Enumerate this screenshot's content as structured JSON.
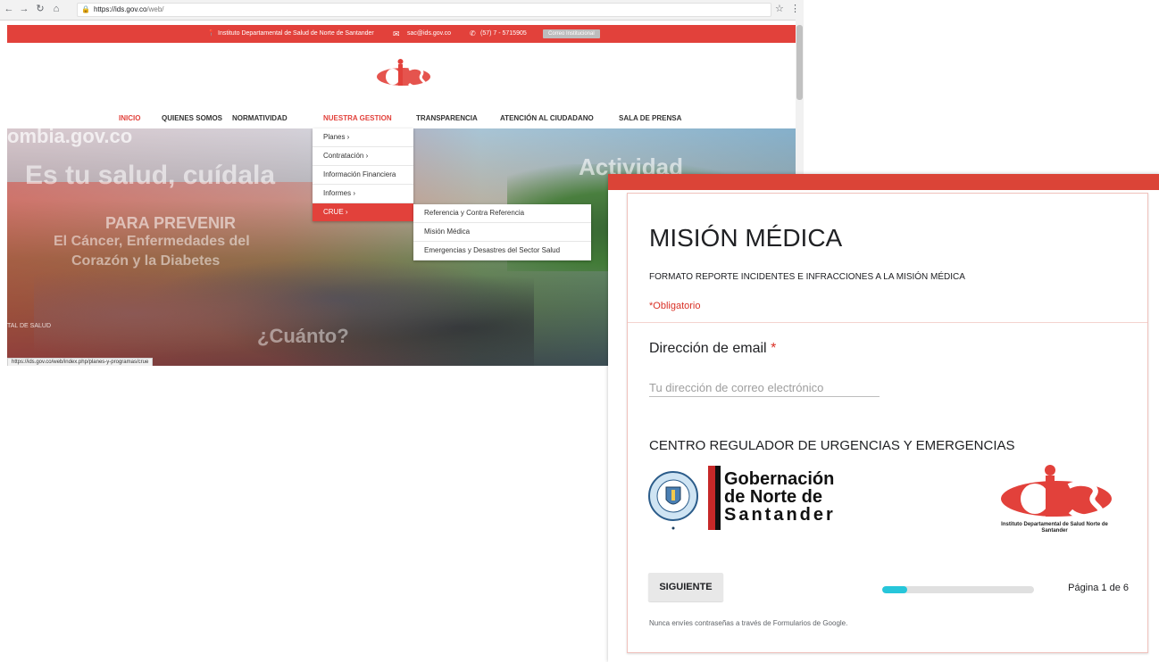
{
  "browser": {
    "url_host": "https://ids.gov.co",
    "url_path": "/web/",
    "status_url": "https://ids.gov.co/web/index.php/planes-y-programas/crue"
  },
  "site": {
    "topbar": {
      "institution": "Instituto Departamental de Salud de Norte de Santander",
      "email": "sac@ids.gov.co",
      "phone": "(57) 7 - 5715905",
      "correo_button": "Correo Institucional"
    },
    "nav": [
      "INICIO",
      "QUIENES SOMOS",
      "NORMATIVIDAD",
      "NUESTRA GESTION",
      "TRANSPARENCIA",
      "ATENCIÓN AL CIUDADANO",
      "SALA DE PRENSA"
    ],
    "banner": {
      "url_text": "ombia.gov.co",
      "slogan": "Es tu salud, cuídala",
      "actividad": "Actividad",
      "prevenir": "PARA PREVENIR",
      "cancer_line": "El Cáncer, Enfermedades del",
      "corazon_line": "Corazón y la Diabetes",
      "salud_label": "TAL DE SALUD",
      "cuanto": "¿Cuánto?"
    },
    "dropdown": [
      "Planes  ›",
      "Contratación  ›",
      "Información Financiera",
      "Informes  ›",
      "CRUE  ›"
    ],
    "submenu": [
      "Referencia y Contra Referencia",
      "Misión Médica",
      "Emergencias y Desastres del Sector Salud"
    ]
  },
  "form": {
    "title": "MISIÓN MÉDICA",
    "description": "FORMATO REPORTE INCIDENTES E INFRACCIONES A LA MISIÓN MÉDICA",
    "required_note": "*Obligatorio",
    "question_label": "Dirección de email",
    "required_star": "*",
    "email_placeholder": "Tu dirección de correo electrónico",
    "section_title": "CENTRO REGULADOR DE URGENCIAS Y EMERGENCIAS",
    "gob_line1": "Gobernación",
    "gob_line2": "de Norte de",
    "gob_line3": "Santander",
    "ids_caption": "Instituto Departamental de Salud Norte de Santander",
    "next_button": "SIGUIENTE",
    "progress_fraction": 0.1667,
    "page_indicator": "Página 1 de 6",
    "footer_note": "Nunca envíes contraseñas a través de Formularios de Google."
  },
  "colors": {
    "accent_red": "#e2413b",
    "form_red": "#db4437",
    "progress": "#26c6da"
  }
}
